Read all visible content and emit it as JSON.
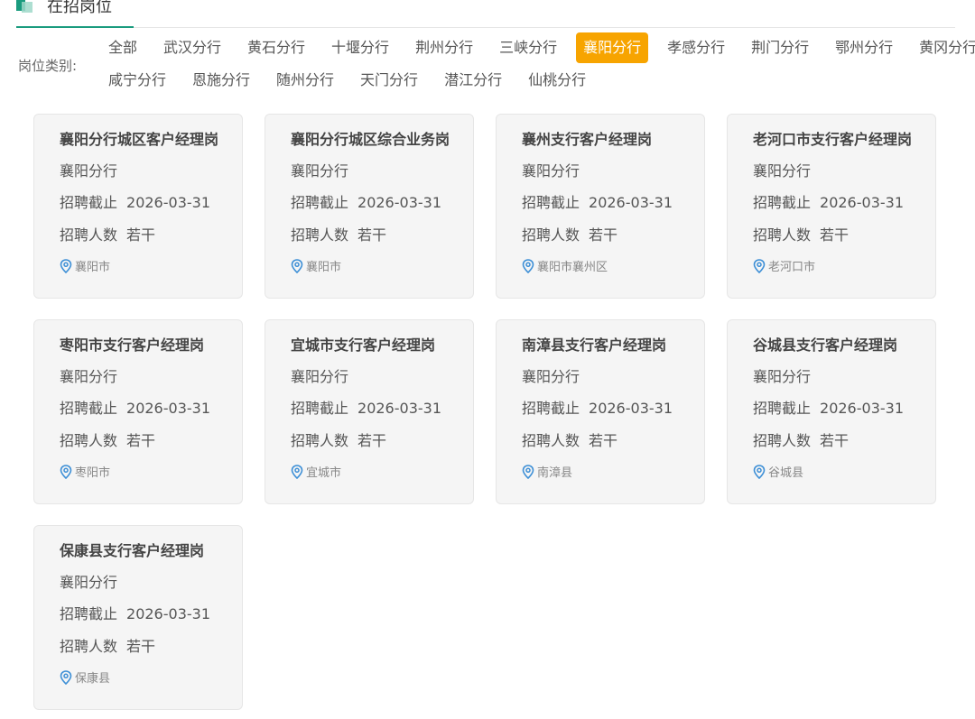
{
  "header": {
    "title": "在招岗位"
  },
  "filter": {
    "label": "岗位类别:",
    "row1": [
      "全部",
      "武汉分行",
      "黄石分行",
      "十堰分行",
      "荆州分行",
      "三峡分行",
      "襄阳分行",
      "孝感分行",
      "荆门分行",
      "鄂州分行",
      "黄冈分行"
    ],
    "row2": [
      "咸宁分行",
      "恩施分行",
      "随州分行",
      "天门分行",
      "潜江分行",
      "仙桃分行"
    ],
    "active": "襄阳分行"
  },
  "colors": {
    "accent": "#1a9b7e",
    "active_bg": "#f7a400",
    "location_icon": "#3d8fd6",
    "card_bg": "#f5f5f5"
  },
  "jobs": [
    {
      "title": "襄阳分行城区客户经理岗",
      "branch": "襄阳分行",
      "deadline_label": "招聘截止",
      "deadline": "2026-03-31",
      "count_label": "招聘人数",
      "count": "若干",
      "location": "襄阳市",
      "icon": "location-pin-icon"
    },
    {
      "title": "襄阳分行城区综合业务岗",
      "branch": "襄阳分行",
      "deadline_label": "招聘截止",
      "deadline": "2026-03-31",
      "count_label": "招聘人数",
      "count": "若干",
      "location": "襄阳市",
      "icon": "location-pin-icon"
    },
    {
      "title": "襄州支行客户经理岗",
      "branch": "襄阳分行",
      "deadline_label": "招聘截止",
      "deadline": "2026-03-31",
      "count_label": "招聘人数",
      "count": "若干",
      "location": "襄阳市襄州区",
      "icon": "location-pin-icon"
    },
    {
      "title": "老河口市支行客户经理岗",
      "branch": "襄阳分行",
      "deadline_label": "招聘截止",
      "deadline": "2026-03-31",
      "count_label": "招聘人数",
      "count": "若干",
      "location": "老河口市",
      "icon": "location-pin-icon"
    },
    {
      "title": "枣阳市支行客户经理岗",
      "branch": "襄阳分行",
      "deadline_label": "招聘截止",
      "deadline": "2026-03-31",
      "count_label": "招聘人数",
      "count": "若干",
      "location": "枣阳市",
      "icon": "location-pin-icon"
    },
    {
      "title": "宜城市支行客户经理岗",
      "branch": "襄阳分行",
      "deadline_label": "招聘截止",
      "deadline": "2026-03-31",
      "count_label": "招聘人数",
      "count": "若干",
      "location": "宜城市",
      "icon": "location-pin-icon"
    },
    {
      "title": "南漳县支行客户经理岗",
      "branch": "襄阳分行",
      "deadline_label": "招聘截止",
      "deadline": "2026-03-31",
      "count_label": "招聘人数",
      "count": "若干",
      "location": "南漳县",
      "icon": "location-pin-icon"
    },
    {
      "title": "谷城县支行客户经理岗",
      "branch": "襄阳分行",
      "deadline_label": "招聘截止",
      "deadline": "2026-03-31",
      "count_label": "招聘人数",
      "count": "若干",
      "location": "谷城县",
      "icon": "location-pin-icon"
    },
    {
      "title": "保康县支行客户经理岗",
      "branch": "襄阳分行",
      "deadline_label": "招聘截止",
      "deadline": "2026-03-31",
      "count_label": "招聘人数",
      "count": "若干",
      "location": "保康县",
      "icon": "location-pin-icon"
    }
  ]
}
